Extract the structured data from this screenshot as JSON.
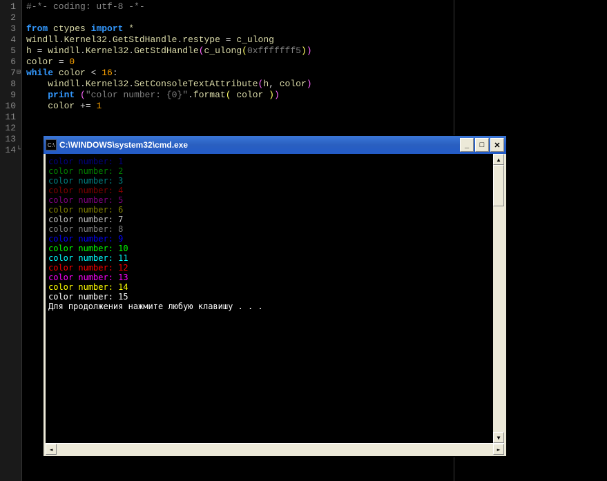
{
  "editor": {
    "line_numbers": [
      "1",
      "2",
      "3",
      "4",
      "5",
      "6",
      "7",
      "8",
      "9",
      "10",
      "11",
      "12",
      "13",
      "14"
    ],
    "lines": [
      {
        "tokens": [
          {
            "t": "#-*- coding: utf-8 -*-",
            "c": "tok-comment"
          }
        ]
      },
      {
        "tokens": []
      },
      {
        "tokens": [
          {
            "t": "from",
            "c": "tok-keyword"
          },
          {
            "t": " ",
            "c": ""
          },
          {
            "t": "ctypes",
            "c": "tok-ident"
          },
          {
            "t": " ",
            "c": ""
          },
          {
            "t": "import",
            "c": "tok-keyword"
          },
          {
            "t": " *",
            "c": "tok-ident"
          }
        ]
      },
      {
        "tokens": [
          {
            "t": "windll",
            "c": "tok-ident"
          },
          {
            "t": ".",
            "c": "tok-dot"
          },
          {
            "t": "Kernel32",
            "c": "tok-ident"
          },
          {
            "t": ".",
            "c": "tok-dot"
          },
          {
            "t": "GetStdHandle",
            "c": "tok-ident"
          },
          {
            "t": ".",
            "c": "tok-dot"
          },
          {
            "t": "restype",
            "c": "tok-ident"
          },
          {
            "t": " = ",
            "c": "tok-op"
          },
          {
            "t": "c_ulong",
            "c": "tok-ident"
          }
        ]
      },
      {
        "tokens": [
          {
            "t": "h",
            "c": "tok-ident"
          },
          {
            "t": " = ",
            "c": "tok-op"
          },
          {
            "t": "windll",
            "c": "tok-ident"
          },
          {
            "t": ".",
            "c": "tok-dot"
          },
          {
            "t": "Kernel32",
            "c": "tok-ident"
          },
          {
            "t": ".",
            "c": "tok-dot"
          },
          {
            "t": "GetStdHandle",
            "c": "tok-ident"
          },
          {
            "t": "(",
            "c": "tok-paren"
          },
          {
            "t": "c_ulong",
            "c": "tok-ident"
          },
          {
            "t": "(",
            "c": "tok-paren2"
          },
          {
            "t": "0xfffffff5",
            "c": "tok-hex"
          },
          {
            "t": ")",
            "c": "tok-paren2"
          },
          {
            "t": ")",
            "c": "tok-paren"
          }
        ]
      },
      {
        "tokens": [
          {
            "t": "color",
            "c": "tok-ident"
          },
          {
            "t": " = ",
            "c": "tok-op"
          },
          {
            "t": "0",
            "c": "tok-num"
          }
        ]
      },
      {
        "fold": "⊟",
        "tokens": [
          {
            "t": "while",
            "c": "tok-keyword"
          },
          {
            "t": " color ",
            "c": "tok-ident"
          },
          {
            "t": "<",
            "c": "tok-op"
          },
          {
            "t": " ",
            "c": ""
          },
          {
            "t": "16",
            "c": "tok-num"
          },
          {
            "t": ":",
            "c": "tok-op"
          }
        ]
      },
      {
        "indent": "    ",
        "tokens": [
          {
            "t": "windll",
            "c": "tok-ident"
          },
          {
            "t": ".",
            "c": "tok-dot"
          },
          {
            "t": "Kernel32",
            "c": "tok-ident"
          },
          {
            "t": ".",
            "c": "tok-dot"
          },
          {
            "t": "SetConsoleTextAttribute",
            "c": "tok-ident"
          },
          {
            "t": "(",
            "c": "tok-paren"
          },
          {
            "t": "h",
            "c": "tok-ident"
          },
          {
            "t": ", ",
            "c": "tok-op"
          },
          {
            "t": "color",
            "c": "tok-ident"
          },
          {
            "t": ")",
            "c": "tok-paren"
          }
        ]
      },
      {
        "indent": "    ",
        "tokens": [
          {
            "t": "print",
            "c": "tok-keyword"
          },
          {
            "t": " ",
            "c": ""
          },
          {
            "t": "(",
            "c": "tok-paren"
          },
          {
            "t": "\"color number: {0}\"",
            "c": "tok-str"
          },
          {
            "t": ".",
            "c": "tok-dot"
          },
          {
            "t": "format",
            "c": "tok-ident"
          },
          {
            "t": "(",
            "c": "tok-paren2"
          },
          {
            "t": " color ",
            "c": "tok-ident"
          },
          {
            "t": ")",
            "c": "tok-paren2"
          },
          {
            "t": ")",
            "c": "tok-paren"
          }
        ]
      },
      {
        "indent": "    ",
        "tokens": [
          {
            "t": "color",
            "c": "tok-ident"
          },
          {
            "t": " += ",
            "c": "tok-op"
          },
          {
            "t": "1",
            "c": "tok-num"
          }
        ]
      },
      {
        "tokens": []
      },
      {
        "tokens": []
      },
      {
        "tokens": []
      },
      {
        "fold": "└",
        "tokens": []
      }
    ]
  },
  "cmd": {
    "title": "C:\\WINDOWS\\system32\\cmd.exe",
    "icon_text": "C:\\",
    "min_glyph": "_",
    "max_glyph": "□",
    "close_glyph": "✕",
    "output": [
      {
        "text": "color number: 1",
        "color": "#000080"
      },
      {
        "text": "color number: 2",
        "color": "#008000"
      },
      {
        "text": "color number: 3",
        "color": "#008080"
      },
      {
        "text": "color number: 4",
        "color": "#800000"
      },
      {
        "text": "color number: 5",
        "color": "#800080"
      },
      {
        "text": "color number: 6",
        "color": "#808000"
      },
      {
        "text": "color number: 7",
        "color": "#c0c0c0"
      },
      {
        "text": "color number: 8",
        "color": "#808080"
      },
      {
        "text": "color number: 9",
        "color": "#0000ff"
      },
      {
        "text": "color number: 10",
        "color": "#00ff00"
      },
      {
        "text": "color number: 11",
        "color": "#00ffff"
      },
      {
        "text": "color number: 12",
        "color": "#ff0000"
      },
      {
        "text": "color number: 13",
        "color": "#ff00ff"
      },
      {
        "text": "color number: 14",
        "color": "#ffff00"
      },
      {
        "text": "color number: 15",
        "color": "#ffffff"
      }
    ],
    "prompt": "Для продолжения нажмите любую клавишу . . .",
    "scroll_up": "▲",
    "scroll_down": "▼",
    "scroll_left": "◄",
    "scroll_right": "►"
  }
}
